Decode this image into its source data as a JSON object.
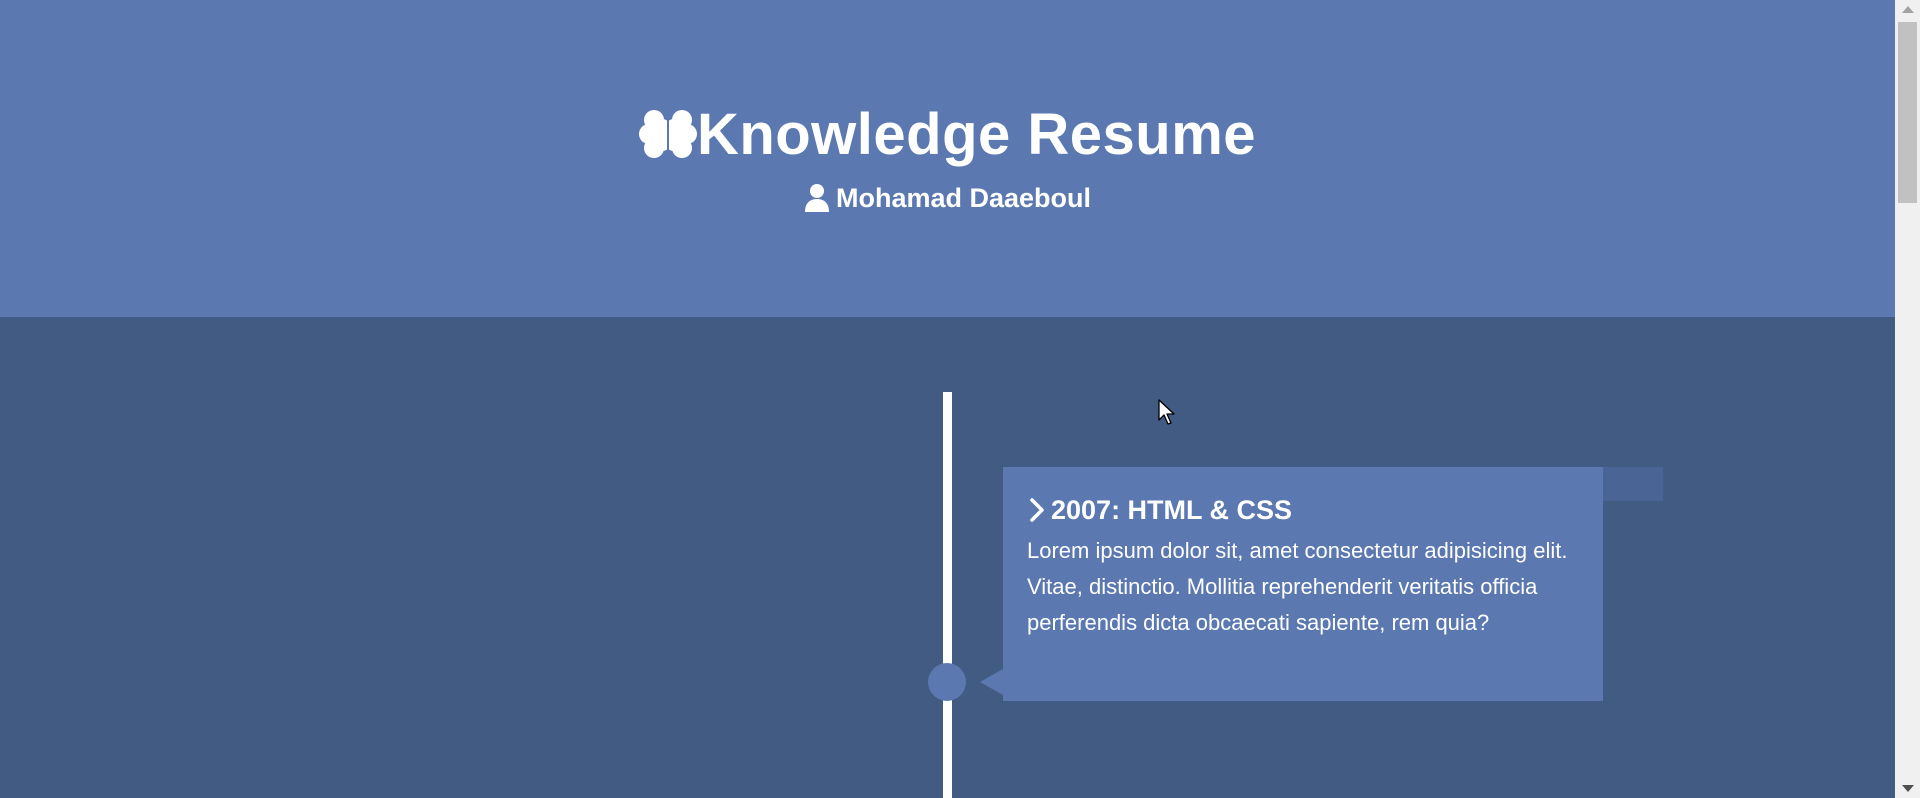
{
  "header": {
    "title": "Knowledge Resume",
    "title_icon": "brain-icon",
    "author": "Mohamad Daaeboul",
    "author_icon": "user-icon",
    "background_color": "#5b78b1"
  },
  "timeline": {
    "background_color": "#425b83",
    "line_color": "#ffffff",
    "entries": [
      {
        "icon": "chevron-right-icon",
        "title": "2007: HTML & CSS",
        "text": "Lorem ipsum dolor sit, amet consectetur adipisicing elit. Vitae, distinctio. Mollitia reprehenderit veritatis officia perferendis dicta obcaecati sapiente, rem quia?",
        "card_color": "#5b78b1"
      }
    ]
  }
}
